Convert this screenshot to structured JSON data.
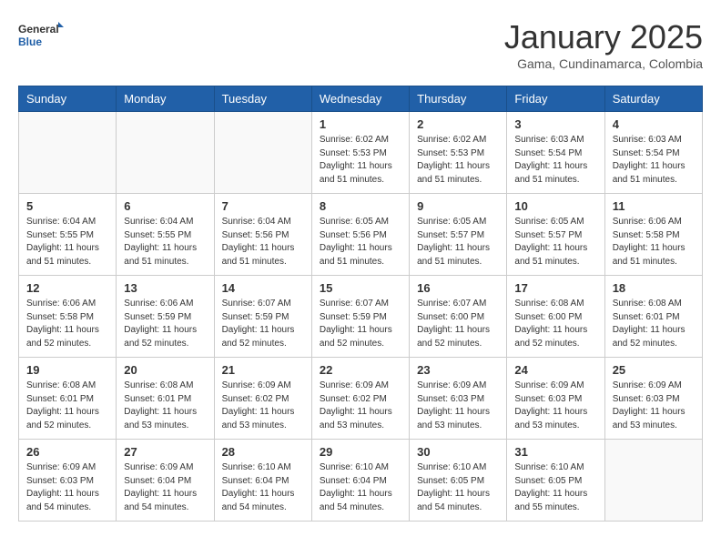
{
  "header": {
    "logo_general": "General",
    "logo_blue": "Blue",
    "month_title": "January 2025",
    "subtitle": "Gama, Cundinamarca, Colombia"
  },
  "days_of_week": [
    "Sunday",
    "Monday",
    "Tuesday",
    "Wednesday",
    "Thursday",
    "Friday",
    "Saturday"
  ],
  "weeks": [
    [
      {
        "day": "",
        "info": ""
      },
      {
        "day": "",
        "info": ""
      },
      {
        "day": "",
        "info": ""
      },
      {
        "day": "1",
        "info": "Sunrise: 6:02 AM\nSunset: 5:53 PM\nDaylight: 11 hours\nand 51 minutes."
      },
      {
        "day": "2",
        "info": "Sunrise: 6:02 AM\nSunset: 5:53 PM\nDaylight: 11 hours\nand 51 minutes."
      },
      {
        "day": "3",
        "info": "Sunrise: 6:03 AM\nSunset: 5:54 PM\nDaylight: 11 hours\nand 51 minutes."
      },
      {
        "day": "4",
        "info": "Sunrise: 6:03 AM\nSunset: 5:54 PM\nDaylight: 11 hours\nand 51 minutes."
      }
    ],
    [
      {
        "day": "5",
        "info": "Sunrise: 6:04 AM\nSunset: 5:55 PM\nDaylight: 11 hours\nand 51 minutes."
      },
      {
        "day": "6",
        "info": "Sunrise: 6:04 AM\nSunset: 5:55 PM\nDaylight: 11 hours\nand 51 minutes."
      },
      {
        "day": "7",
        "info": "Sunrise: 6:04 AM\nSunset: 5:56 PM\nDaylight: 11 hours\nand 51 minutes."
      },
      {
        "day": "8",
        "info": "Sunrise: 6:05 AM\nSunset: 5:56 PM\nDaylight: 11 hours\nand 51 minutes."
      },
      {
        "day": "9",
        "info": "Sunrise: 6:05 AM\nSunset: 5:57 PM\nDaylight: 11 hours\nand 51 minutes."
      },
      {
        "day": "10",
        "info": "Sunrise: 6:05 AM\nSunset: 5:57 PM\nDaylight: 11 hours\nand 51 minutes."
      },
      {
        "day": "11",
        "info": "Sunrise: 6:06 AM\nSunset: 5:58 PM\nDaylight: 11 hours\nand 51 minutes."
      }
    ],
    [
      {
        "day": "12",
        "info": "Sunrise: 6:06 AM\nSunset: 5:58 PM\nDaylight: 11 hours\nand 52 minutes."
      },
      {
        "day": "13",
        "info": "Sunrise: 6:06 AM\nSunset: 5:59 PM\nDaylight: 11 hours\nand 52 minutes."
      },
      {
        "day": "14",
        "info": "Sunrise: 6:07 AM\nSunset: 5:59 PM\nDaylight: 11 hours\nand 52 minutes."
      },
      {
        "day": "15",
        "info": "Sunrise: 6:07 AM\nSunset: 5:59 PM\nDaylight: 11 hours\nand 52 minutes."
      },
      {
        "day": "16",
        "info": "Sunrise: 6:07 AM\nSunset: 6:00 PM\nDaylight: 11 hours\nand 52 minutes."
      },
      {
        "day": "17",
        "info": "Sunrise: 6:08 AM\nSunset: 6:00 PM\nDaylight: 11 hours\nand 52 minutes."
      },
      {
        "day": "18",
        "info": "Sunrise: 6:08 AM\nSunset: 6:01 PM\nDaylight: 11 hours\nand 52 minutes."
      }
    ],
    [
      {
        "day": "19",
        "info": "Sunrise: 6:08 AM\nSunset: 6:01 PM\nDaylight: 11 hours\nand 52 minutes."
      },
      {
        "day": "20",
        "info": "Sunrise: 6:08 AM\nSunset: 6:01 PM\nDaylight: 11 hours\nand 53 minutes."
      },
      {
        "day": "21",
        "info": "Sunrise: 6:09 AM\nSunset: 6:02 PM\nDaylight: 11 hours\nand 53 minutes."
      },
      {
        "day": "22",
        "info": "Sunrise: 6:09 AM\nSunset: 6:02 PM\nDaylight: 11 hours\nand 53 minutes."
      },
      {
        "day": "23",
        "info": "Sunrise: 6:09 AM\nSunset: 6:03 PM\nDaylight: 11 hours\nand 53 minutes."
      },
      {
        "day": "24",
        "info": "Sunrise: 6:09 AM\nSunset: 6:03 PM\nDaylight: 11 hours\nand 53 minutes."
      },
      {
        "day": "25",
        "info": "Sunrise: 6:09 AM\nSunset: 6:03 PM\nDaylight: 11 hours\nand 53 minutes."
      }
    ],
    [
      {
        "day": "26",
        "info": "Sunrise: 6:09 AM\nSunset: 6:03 PM\nDaylight: 11 hours\nand 54 minutes."
      },
      {
        "day": "27",
        "info": "Sunrise: 6:09 AM\nSunset: 6:04 PM\nDaylight: 11 hours\nand 54 minutes."
      },
      {
        "day": "28",
        "info": "Sunrise: 6:10 AM\nSunset: 6:04 PM\nDaylight: 11 hours\nand 54 minutes."
      },
      {
        "day": "29",
        "info": "Sunrise: 6:10 AM\nSunset: 6:04 PM\nDaylight: 11 hours\nand 54 minutes."
      },
      {
        "day": "30",
        "info": "Sunrise: 6:10 AM\nSunset: 6:05 PM\nDaylight: 11 hours\nand 54 minutes."
      },
      {
        "day": "31",
        "info": "Sunrise: 6:10 AM\nSunset: 6:05 PM\nDaylight: 11 hours\nand 55 minutes."
      },
      {
        "day": "",
        "info": ""
      }
    ]
  ]
}
